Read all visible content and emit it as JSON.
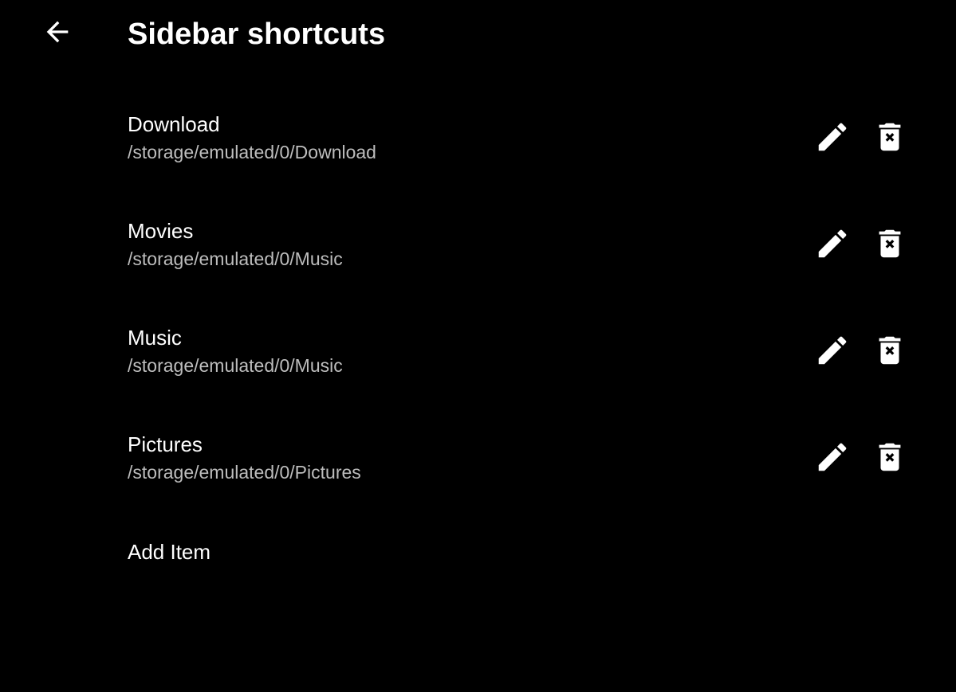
{
  "header": {
    "title": "Sidebar shortcuts",
    "back_icon": "arrow-back-icon"
  },
  "shortcuts": [
    {
      "name": "Download",
      "path": "/storage/emulated/0/Download"
    },
    {
      "name": "Movies",
      "path": "/storage/emulated/0/Music"
    },
    {
      "name": "Music",
      "path": "/storage/emulated/0/Music"
    },
    {
      "name": "Pictures",
      "path": "/storage/emulated/0/Pictures"
    }
  ],
  "actions": {
    "edit_icon": "pencil-icon",
    "delete_icon": "trash-icon"
  },
  "add_item_label": "Add Item",
  "colors": {
    "background": "#000000",
    "primary_text": "#ffffff",
    "secondary_text": "#bdbdbd"
  }
}
